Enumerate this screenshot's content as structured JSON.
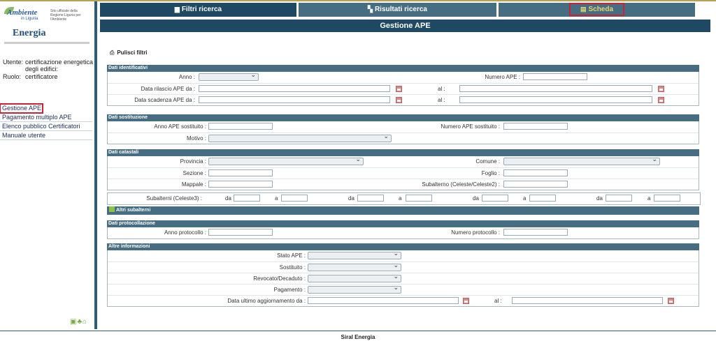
{
  "brand": {
    "name": "Ambiente",
    "sub": "in Liguria",
    "tagline": "Sito ufficiale della Regione Liguria per l'Ambiente",
    "app_name": "Energia"
  },
  "user": {
    "utente_label": "Utente:",
    "utente_value": "certificazione energetica degli edifici:",
    "ruolo_label": "Ruolo:",
    "ruolo_value": "certificatore"
  },
  "nav": {
    "items": [
      "Gestione APE",
      "Pagamento multiplo APE",
      "Elenco pubblico Certificatori",
      "Manuale utente"
    ]
  },
  "side_icons": "▣♣⌂",
  "tabs": [
    {
      "label": "Filtri ricerca",
      "icon": "document-icon"
    },
    {
      "label": "Risultati ricerca",
      "icon": "book-icon"
    },
    {
      "label": "Scheda",
      "icon": "sheet-icon"
    }
  ],
  "page_title": "Gestione APE",
  "pulisci_label": "Pulisci filtri",
  "sections": {
    "identificativi": {
      "title": "Dati identificativi",
      "anno": "Anno :",
      "numero_ape": "Numero APE :",
      "data_rilascio": "Data rilascio APE da :",
      "data_scadenza": "Data scadenza APE da :",
      "al": "al :"
    },
    "sostituzione": {
      "title": "Dati sostituzione",
      "anno_sost": "Anno APE sostituito :",
      "numero_sost": "Numero APE sostituito :",
      "motivo": "Motivo :"
    },
    "catastali": {
      "title": "Dati catastali",
      "provincia": "Provincia :",
      "comune": "Comune :",
      "sezione": "Sezione :",
      "foglio": "Foglio :",
      "mappale": "Mappale :",
      "subalterno": "Subalterno (Celeste/Celeste2) :",
      "subalterni3": "Subalterni (Celeste3) :",
      "da": "da",
      "a": "a",
      "altri": "Altri subalterni"
    },
    "protocollazione": {
      "title": "Dati protocollazione",
      "anno_prot": "Anno protocollo :",
      "numero_prot": "Numero protocollo :"
    },
    "altre": {
      "title": "Altre informazioni",
      "stato": "Stato APE :",
      "sostituito": "Sostituito :",
      "revocato": "Revocato/Decaduto :",
      "pagamento": "Pagamento :",
      "data_agg": "Data ultimo aggiornamento da :",
      "al": "al :"
    }
  },
  "footer": "Siral Energia"
}
